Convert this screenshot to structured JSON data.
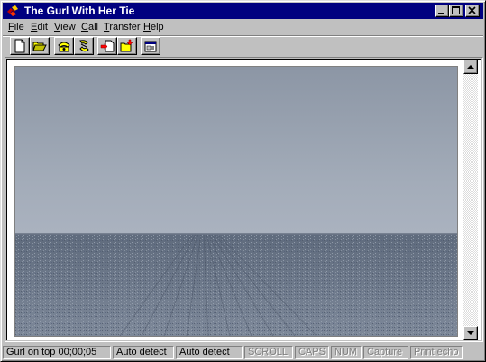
{
  "window": {
    "title": "The Gurl With Her Tie",
    "icon": "hyperterminal-phone-icon"
  },
  "menu": [
    {
      "label": "File",
      "accel": "F",
      "rest": "ile"
    },
    {
      "label": "Edit",
      "accel": "E",
      "rest": "dit"
    },
    {
      "label": "View",
      "accel": "V",
      "rest": "iew"
    },
    {
      "label": "Call",
      "accel": "C",
      "rest": "all"
    },
    {
      "label": "Transfer",
      "accel": "T",
      "rest": "ransfer"
    },
    {
      "label": "Help",
      "accel": "H",
      "rest": "elp"
    }
  ],
  "toolbar": {
    "buttons": [
      "new-icon",
      "open-icon",
      "connect-icon",
      "disconnect-icon",
      "send-icon",
      "receive-icon",
      "properties-icon"
    ]
  },
  "status": {
    "connection": "Gurl on top 00;00;05",
    "detect_1": "Auto detect",
    "detect_2": "Auto detect",
    "scroll": "SCROLL",
    "caps": "CAPS",
    "num": "NUM",
    "capture": "Capture",
    "print_echo": "Print echo"
  },
  "colors": {
    "titlebar": "#000080",
    "sky": "#9aa3b1",
    "field": "#6f7c8d"
  }
}
